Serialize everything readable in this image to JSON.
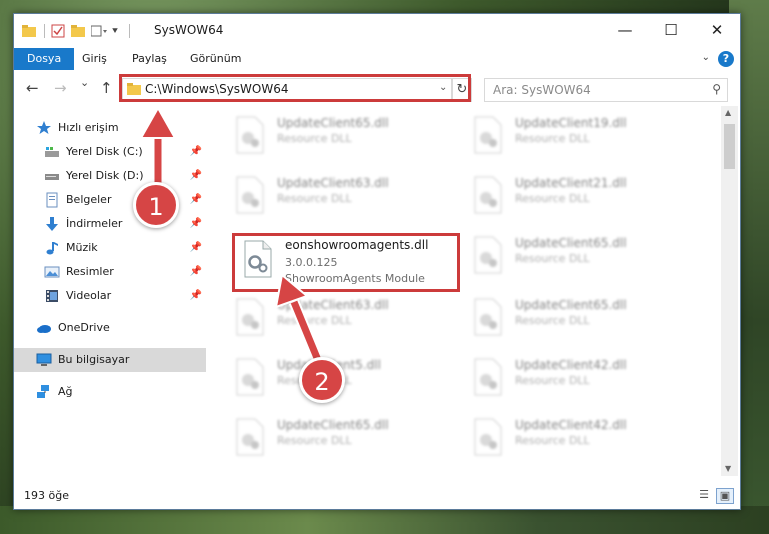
{
  "window": {
    "title": "SysWOW64",
    "controls": {
      "minimize": "—",
      "maximize": "☐",
      "close": "✕"
    }
  },
  "ribbon": {
    "tabs": [
      {
        "label": "Dosya",
        "active": true
      },
      {
        "label": "Giriş",
        "active": false
      },
      {
        "label": "Paylaş",
        "active": false
      },
      {
        "label": "Görünüm",
        "active": false
      }
    ],
    "help": "?"
  },
  "navigation": {
    "back_icon": "←",
    "forward_icon": "→",
    "recent_icon": "⌄",
    "up_icon": "↑",
    "address": "C:\\Windows\\SysWOW64",
    "refresh_icon": "↻",
    "search_placeholder": "Ara: SysWOW64"
  },
  "sidebar": {
    "items": [
      {
        "label": "Hızlı erişim",
        "icon": "star-icon",
        "pinned": false
      },
      {
        "label": "Yerel Disk (C:)",
        "icon": "drive-icon",
        "pinned": true
      },
      {
        "label": "Yerel Disk (D:)",
        "icon": "drive-icon",
        "pinned": true
      },
      {
        "label": "Belgeler",
        "icon": "document-icon",
        "pinned": true
      },
      {
        "label": "İndirmeler",
        "icon": "download-icon",
        "pinned": true
      },
      {
        "label": "Müzik",
        "icon": "music-icon",
        "pinned": true
      },
      {
        "label": "Resimler",
        "icon": "picture-icon",
        "pinned": true
      },
      {
        "label": "Videolar",
        "icon": "video-icon",
        "pinned": true
      },
      {
        "label": "OneDrive",
        "icon": "cloud-icon",
        "pinned": false
      },
      {
        "label": "Bu bilgisayar",
        "icon": "computer-icon",
        "pinned": false,
        "selected": true
      },
      {
        "label": "Ağ",
        "icon": "network-icon",
        "pinned": false
      }
    ]
  },
  "files": {
    "col1": [
      {
        "name": "UpdateClient65.dll",
        "line2": "Resource DLL",
        "line3": ""
      },
      {
        "name": "UpdateClient63.dll",
        "line2": "Resource DLL",
        "line3": ""
      },
      {
        "name": "eonshowroomagents.dll",
        "line2": "3.0.0.125",
        "line3": "ShowroomAgents Module",
        "highlighted": true
      },
      {
        "name": "UpdateClient63.dll",
        "line2": "Resource DLL",
        "line3": ""
      },
      {
        "name": "UpdateClient5.dll",
        "line2": "Resource DLL",
        "line3": ""
      },
      {
        "name": "UpdateClient65.dll",
        "line2": "Resource DLL",
        "line3": ""
      }
    ],
    "col2": [
      {
        "name": "UpdateClient19.dll",
        "line2": "Resource DLL"
      },
      {
        "name": "UpdateClient21.dll",
        "line2": "Resource DLL"
      },
      {
        "name": "UpdateClient65.dll",
        "line2": "Resource DLL"
      },
      {
        "name": "UpdateClient65.dll",
        "line2": "Resource DLL"
      },
      {
        "name": "UpdateClient42.dll",
        "line2": "Resource DLL"
      },
      {
        "name": "UpdateClient42.dll",
        "line2": "Resource DLL"
      }
    ]
  },
  "status": {
    "count": "193 öğe"
  },
  "annotations": {
    "step1": "1",
    "step2": "2",
    "color": "#d64545"
  }
}
